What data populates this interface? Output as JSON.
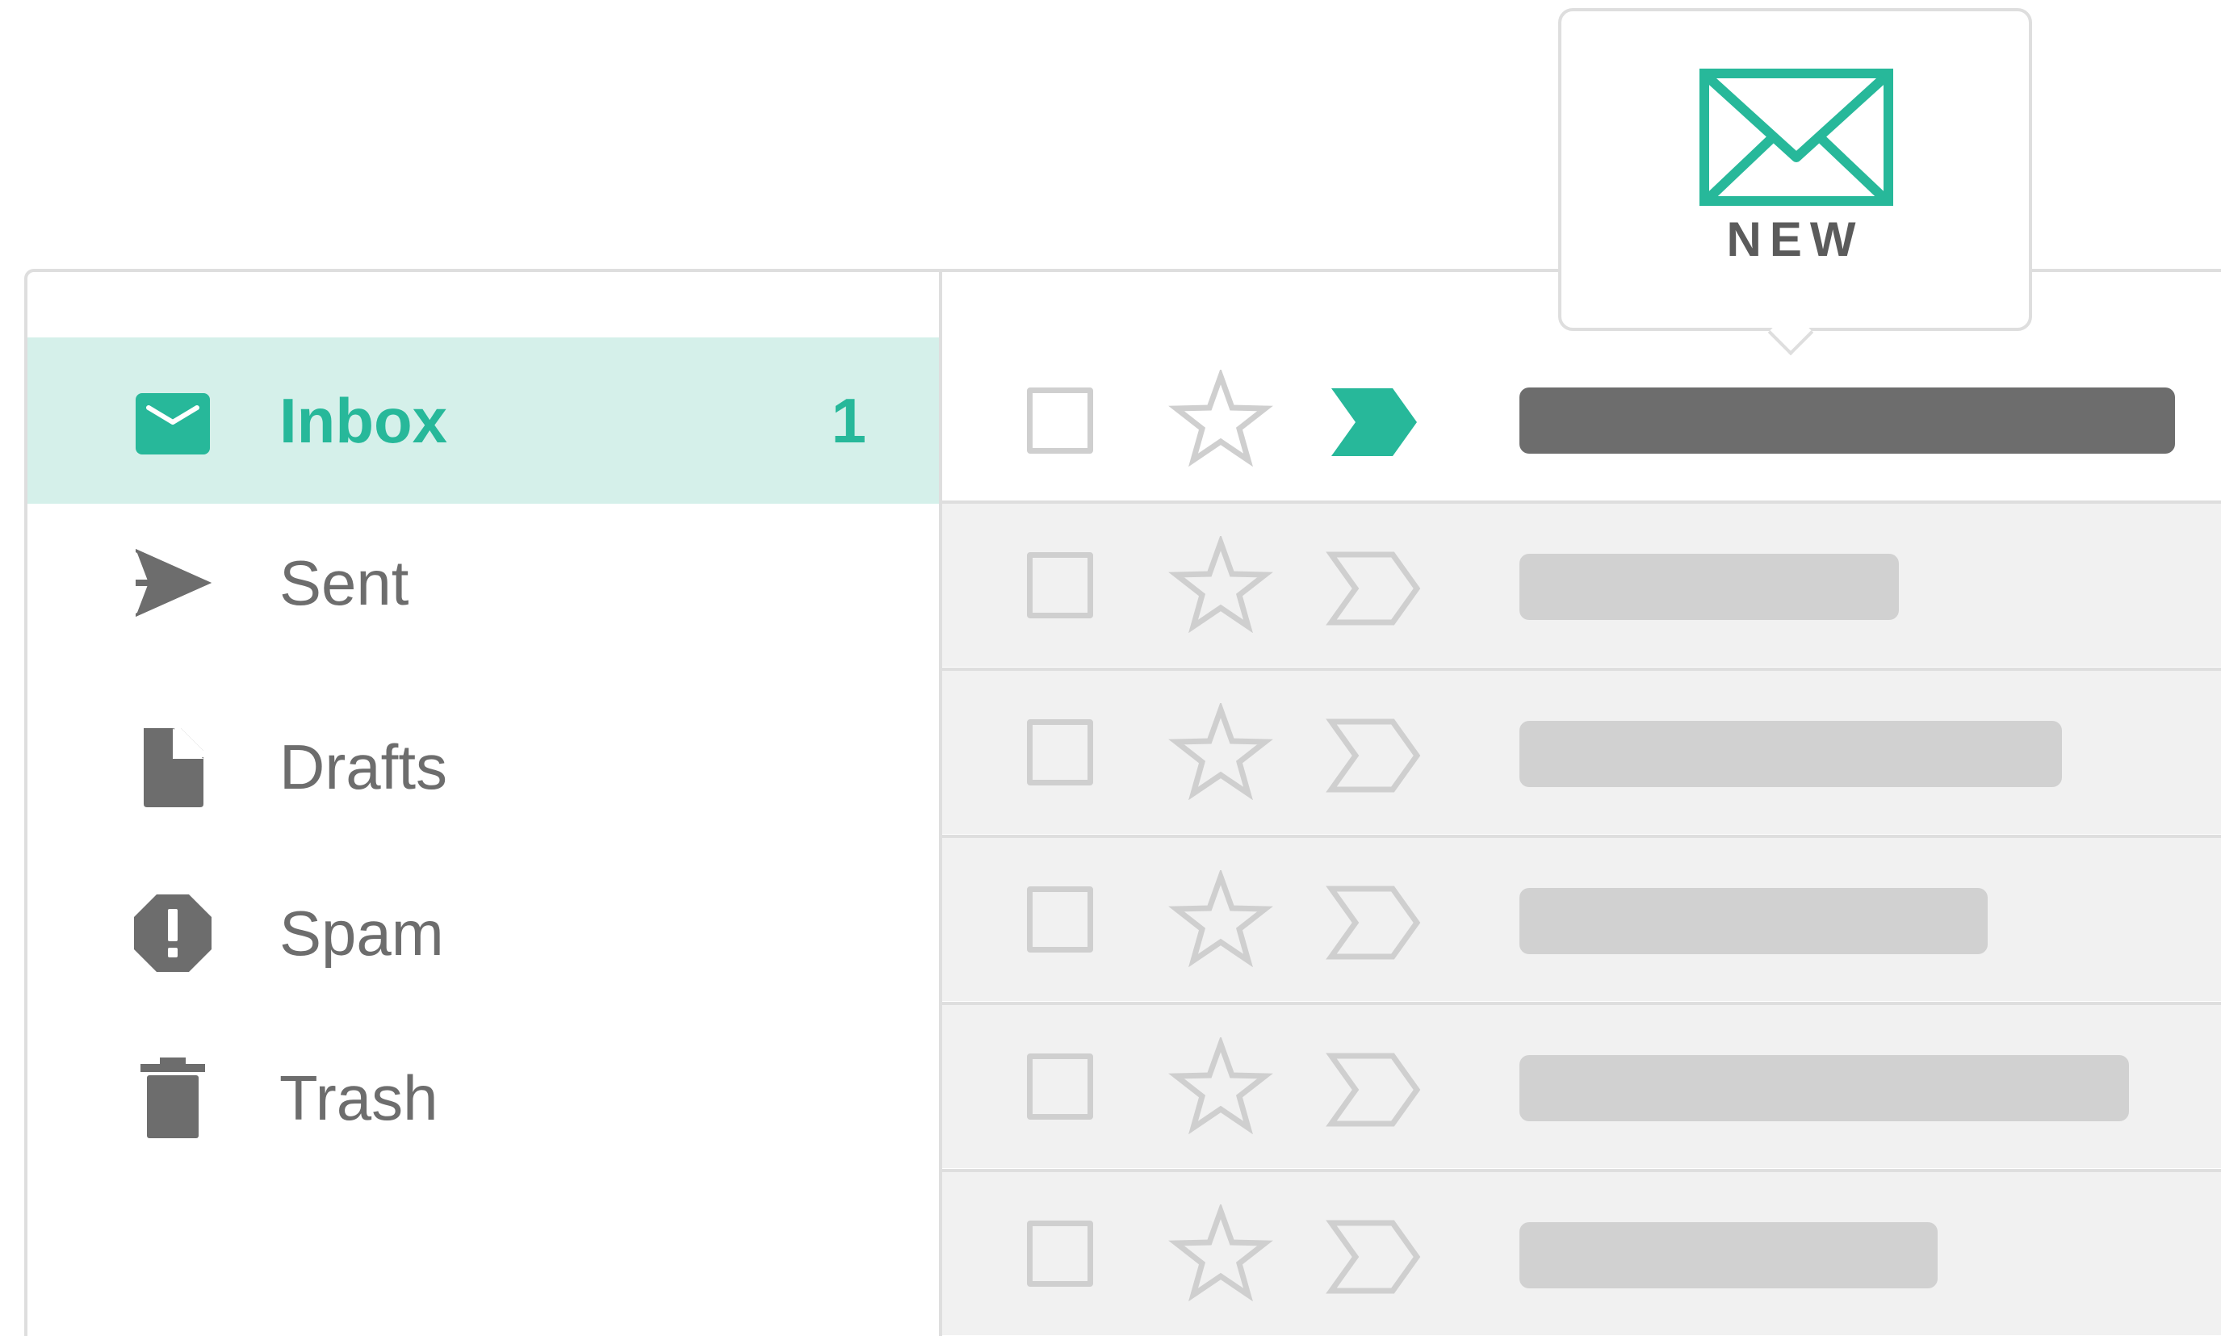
{
  "colors": {
    "accent": "#27b89a",
    "accent_light": "#d5f0ea",
    "text_gray": "#6d6d6d",
    "placeholder_gray": "#d1d1d1",
    "border": "#dedede"
  },
  "notification": {
    "icon": "envelope-icon",
    "label": "NEW"
  },
  "sidebar": {
    "items": [
      {
        "label": "Inbox",
        "icon": "inbox-icon",
        "count": "1",
        "active": true
      },
      {
        "label": "Sent",
        "icon": "send-icon",
        "count": "",
        "active": false
      },
      {
        "label": "Drafts",
        "icon": "draft-document-icon",
        "count": "",
        "active": false
      },
      {
        "label": "Spam",
        "icon": "spam-warning-icon",
        "count": "",
        "active": false
      },
      {
        "label": "Trash",
        "icon": "trash-icon",
        "count": "",
        "active": false
      }
    ]
  },
  "email_list": {
    "rows": [
      {
        "unread": true,
        "starred": false,
        "important": true
      },
      {
        "unread": false,
        "starred": false,
        "important": false
      },
      {
        "unread": false,
        "starred": false,
        "important": false
      },
      {
        "unread": false,
        "starred": false,
        "important": false
      },
      {
        "unread": false,
        "starred": false,
        "important": false
      },
      {
        "unread": false,
        "starred": false,
        "important": false
      }
    ]
  }
}
